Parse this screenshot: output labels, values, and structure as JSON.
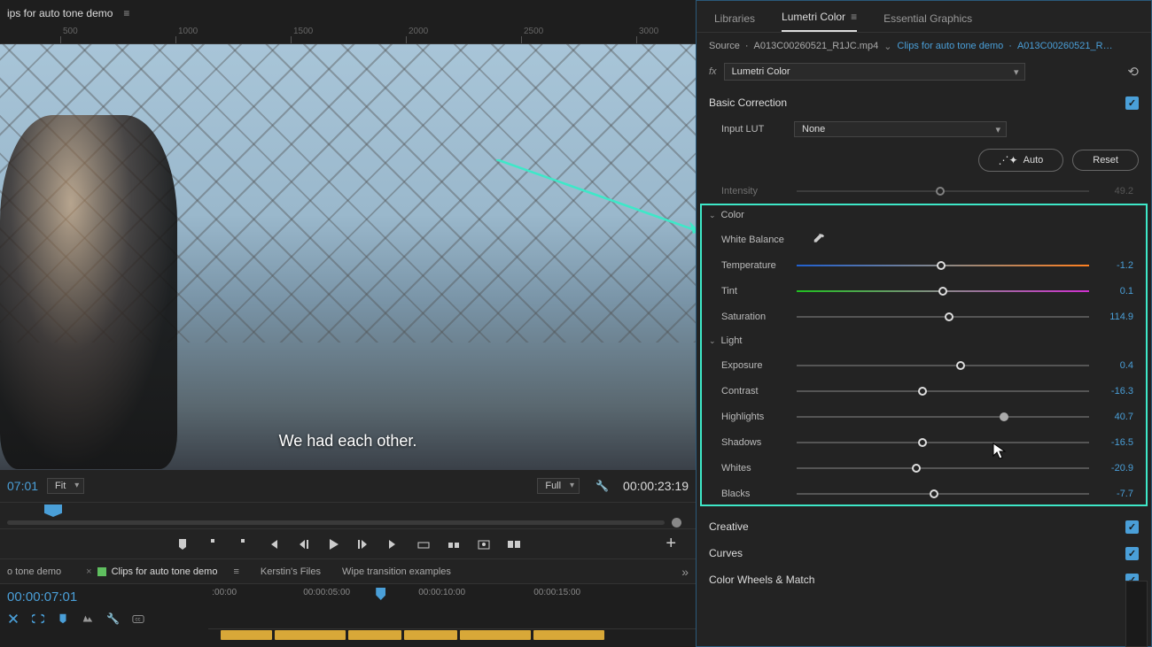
{
  "left": {
    "tab_label": "ips for auto tone demo",
    "ruler_ticks": [
      "500",
      "1000",
      "1500",
      "2000",
      "2500",
      "3000"
    ],
    "subtitle": "We had each other.",
    "playback": {
      "tc_left": "07:01",
      "fit_dropdown": "Fit",
      "quality_dropdown": "Full",
      "tc_right": "00:00:23:19"
    },
    "sequence_tabs": {
      "prev_tab": "o tone demo",
      "active_tab": "Clips for auto tone demo",
      "tab3": "Kerstin's Files",
      "tab4": "Wipe transition examples"
    },
    "timeline": {
      "tc": "00:00:07:01",
      "ticks": [
        ":00:00",
        "00:00:05:00",
        "00:00:10:00",
        "00:00:15:00"
      ]
    }
  },
  "right": {
    "tabs": {
      "libraries": "Libraries",
      "lumetri": "Lumetri Color",
      "graphics": "Essential Graphics"
    },
    "breadcrumb": {
      "source_label": "Source",
      "source_clip": "A013C00260521_R1JC.mp4",
      "active_seq": "Clips for auto tone demo",
      "active_clip": "A013C00260521_R…"
    },
    "effect_name": "Lumetri Color",
    "basic_correction": {
      "title": "Basic Correction",
      "input_lut_label": "Input LUT",
      "input_lut_value": "None",
      "auto_btn": "Auto",
      "reset_btn": "Reset",
      "intensity_label": "Intensity",
      "intensity_value": "49.2",
      "color": {
        "title": "Color",
        "white_balance": "White Balance",
        "temperature": {
          "label": "Temperature",
          "value": "-1.2",
          "pos": 49.5
        },
        "tint": {
          "label": "Tint",
          "value": "0.1",
          "pos": 50
        },
        "saturation": {
          "label": "Saturation",
          "value": "114.9",
          "pos": 52
        }
      },
      "light": {
        "title": "Light",
        "exposure": {
          "label": "Exposure",
          "value": "0.4",
          "pos": 56
        },
        "contrast": {
          "label": "Contrast",
          "value": "-16.3",
          "pos": 43
        },
        "highlights": {
          "label": "Highlights",
          "value": "40.7",
          "pos": 71
        },
        "shadows": {
          "label": "Shadows",
          "value": "-16.5",
          "pos": 43
        },
        "whites": {
          "label": "Whites",
          "value": "-20.9",
          "pos": 41
        },
        "blacks": {
          "label": "Blacks",
          "value": "-7.7",
          "pos": 47
        }
      }
    },
    "sections": {
      "creative": "Creative",
      "curves": "Curves",
      "wheels": "Color Wheels & Match"
    }
  }
}
